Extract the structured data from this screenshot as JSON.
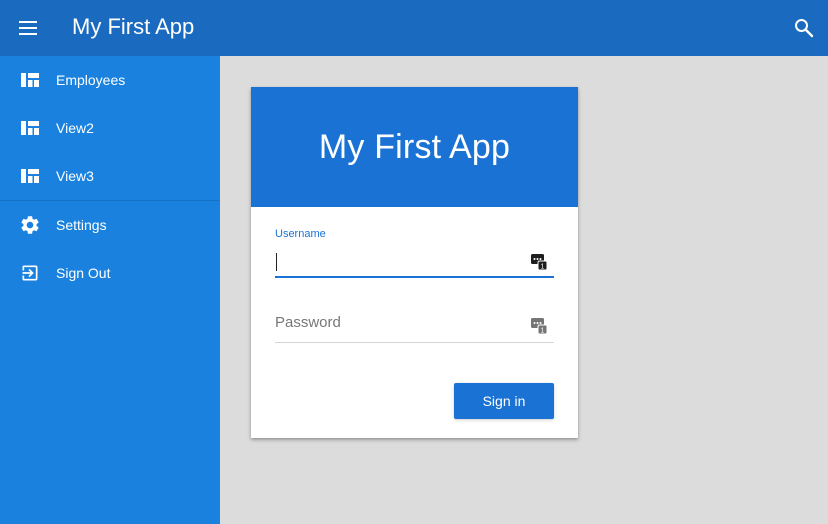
{
  "appbar": {
    "title": "My First App",
    "menu_icon": "hamburger-menu-icon",
    "search_icon": "search-icon",
    "color": "#1a6bbf"
  },
  "sidebar": {
    "color": "#1a82de",
    "items": [
      {
        "label": "Employees",
        "icon": "dashboard-icon"
      },
      {
        "label": "View2",
        "icon": "dashboard-icon"
      },
      {
        "label": "View3",
        "icon": "dashboard-icon"
      },
      {
        "label": "Settings",
        "icon": "gear-icon"
      },
      {
        "label": "Sign Out",
        "icon": "exit-icon"
      }
    ]
  },
  "login": {
    "header_title": "My First App",
    "header_color": "#1a73d4",
    "username_label": "Username",
    "username_value": "",
    "password_placeholder": "Password",
    "password_value": "",
    "signin_label": "Sign in"
  }
}
